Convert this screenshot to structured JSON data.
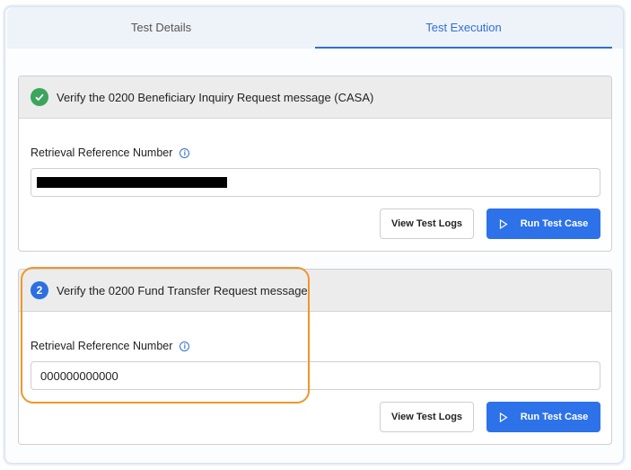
{
  "tabs": [
    {
      "label": "Test Details"
    },
    {
      "label": "Test Execution"
    }
  ],
  "cards": [
    {
      "status_icon": "check-icon",
      "title": "Verify the 0200 Beneficiary Inquiry Request message (CASA)",
      "field_label": "Retrieval Reference Number",
      "field_value": "",
      "logs_label": "View Test Logs",
      "run_label": "Run Test Case"
    },
    {
      "step_number": "2",
      "title": "Verify the 0200 Fund Transfer Request message",
      "field_label": "Retrieval Reference Number",
      "field_value": "000000000000",
      "logs_label": "View Test Logs",
      "run_label": "Run Test Case"
    }
  ],
  "colors": {
    "accent": "#2d72e8",
    "success": "#3ba55c",
    "highlight": "#f0962a"
  }
}
